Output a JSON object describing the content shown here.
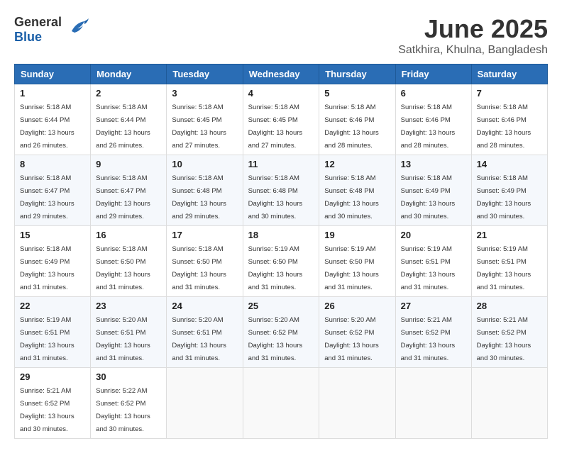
{
  "header": {
    "logo_general": "General",
    "logo_blue": "Blue",
    "month": "June 2025",
    "location": "Satkhira, Khulna, Bangladesh"
  },
  "days_of_week": [
    "Sunday",
    "Monday",
    "Tuesday",
    "Wednesday",
    "Thursday",
    "Friday",
    "Saturday"
  ],
  "weeks": [
    [
      {
        "day": "1",
        "sunrise": "Sunrise: 5:18 AM",
        "sunset": "Sunset: 6:44 PM",
        "daylight": "Daylight: 13 hours and 26 minutes."
      },
      {
        "day": "2",
        "sunrise": "Sunrise: 5:18 AM",
        "sunset": "Sunset: 6:44 PM",
        "daylight": "Daylight: 13 hours and 26 minutes."
      },
      {
        "day": "3",
        "sunrise": "Sunrise: 5:18 AM",
        "sunset": "Sunset: 6:45 PM",
        "daylight": "Daylight: 13 hours and 27 minutes."
      },
      {
        "day": "4",
        "sunrise": "Sunrise: 5:18 AM",
        "sunset": "Sunset: 6:45 PM",
        "daylight": "Daylight: 13 hours and 27 minutes."
      },
      {
        "day": "5",
        "sunrise": "Sunrise: 5:18 AM",
        "sunset": "Sunset: 6:46 PM",
        "daylight": "Daylight: 13 hours and 28 minutes."
      },
      {
        "day": "6",
        "sunrise": "Sunrise: 5:18 AM",
        "sunset": "Sunset: 6:46 PM",
        "daylight": "Daylight: 13 hours and 28 minutes."
      },
      {
        "day": "7",
        "sunrise": "Sunrise: 5:18 AM",
        "sunset": "Sunset: 6:46 PM",
        "daylight": "Daylight: 13 hours and 28 minutes."
      }
    ],
    [
      {
        "day": "8",
        "sunrise": "Sunrise: 5:18 AM",
        "sunset": "Sunset: 6:47 PM",
        "daylight": "Daylight: 13 hours and 29 minutes."
      },
      {
        "day": "9",
        "sunrise": "Sunrise: 5:18 AM",
        "sunset": "Sunset: 6:47 PM",
        "daylight": "Daylight: 13 hours and 29 minutes."
      },
      {
        "day": "10",
        "sunrise": "Sunrise: 5:18 AM",
        "sunset": "Sunset: 6:48 PM",
        "daylight": "Daylight: 13 hours and 29 minutes."
      },
      {
        "day": "11",
        "sunrise": "Sunrise: 5:18 AM",
        "sunset": "Sunset: 6:48 PM",
        "daylight": "Daylight: 13 hours and 30 minutes."
      },
      {
        "day": "12",
        "sunrise": "Sunrise: 5:18 AM",
        "sunset": "Sunset: 6:48 PM",
        "daylight": "Daylight: 13 hours and 30 minutes."
      },
      {
        "day": "13",
        "sunrise": "Sunrise: 5:18 AM",
        "sunset": "Sunset: 6:49 PM",
        "daylight": "Daylight: 13 hours and 30 minutes."
      },
      {
        "day": "14",
        "sunrise": "Sunrise: 5:18 AM",
        "sunset": "Sunset: 6:49 PM",
        "daylight": "Daylight: 13 hours and 30 minutes."
      }
    ],
    [
      {
        "day": "15",
        "sunrise": "Sunrise: 5:18 AM",
        "sunset": "Sunset: 6:49 PM",
        "daylight": "Daylight: 13 hours and 31 minutes."
      },
      {
        "day": "16",
        "sunrise": "Sunrise: 5:18 AM",
        "sunset": "Sunset: 6:50 PM",
        "daylight": "Daylight: 13 hours and 31 minutes."
      },
      {
        "day": "17",
        "sunrise": "Sunrise: 5:18 AM",
        "sunset": "Sunset: 6:50 PM",
        "daylight": "Daylight: 13 hours and 31 minutes."
      },
      {
        "day": "18",
        "sunrise": "Sunrise: 5:19 AM",
        "sunset": "Sunset: 6:50 PM",
        "daylight": "Daylight: 13 hours and 31 minutes."
      },
      {
        "day": "19",
        "sunrise": "Sunrise: 5:19 AM",
        "sunset": "Sunset: 6:50 PM",
        "daylight": "Daylight: 13 hours and 31 minutes."
      },
      {
        "day": "20",
        "sunrise": "Sunrise: 5:19 AM",
        "sunset": "Sunset: 6:51 PM",
        "daylight": "Daylight: 13 hours and 31 minutes."
      },
      {
        "day": "21",
        "sunrise": "Sunrise: 5:19 AM",
        "sunset": "Sunset: 6:51 PM",
        "daylight": "Daylight: 13 hours and 31 minutes."
      }
    ],
    [
      {
        "day": "22",
        "sunrise": "Sunrise: 5:19 AM",
        "sunset": "Sunset: 6:51 PM",
        "daylight": "Daylight: 13 hours and 31 minutes."
      },
      {
        "day": "23",
        "sunrise": "Sunrise: 5:20 AM",
        "sunset": "Sunset: 6:51 PM",
        "daylight": "Daylight: 13 hours and 31 minutes."
      },
      {
        "day": "24",
        "sunrise": "Sunrise: 5:20 AM",
        "sunset": "Sunset: 6:51 PM",
        "daylight": "Daylight: 13 hours and 31 minutes."
      },
      {
        "day": "25",
        "sunrise": "Sunrise: 5:20 AM",
        "sunset": "Sunset: 6:52 PM",
        "daylight": "Daylight: 13 hours and 31 minutes."
      },
      {
        "day": "26",
        "sunrise": "Sunrise: 5:20 AM",
        "sunset": "Sunset: 6:52 PM",
        "daylight": "Daylight: 13 hours and 31 minutes."
      },
      {
        "day": "27",
        "sunrise": "Sunrise: 5:21 AM",
        "sunset": "Sunset: 6:52 PM",
        "daylight": "Daylight: 13 hours and 31 minutes."
      },
      {
        "day": "28",
        "sunrise": "Sunrise: 5:21 AM",
        "sunset": "Sunset: 6:52 PM",
        "daylight": "Daylight: 13 hours and 30 minutes."
      }
    ],
    [
      {
        "day": "29",
        "sunrise": "Sunrise: 5:21 AM",
        "sunset": "Sunset: 6:52 PM",
        "daylight": "Daylight: 13 hours and 30 minutes."
      },
      {
        "day": "30",
        "sunrise": "Sunrise: 5:22 AM",
        "sunset": "Sunset: 6:52 PM",
        "daylight": "Daylight: 13 hours and 30 minutes."
      },
      null,
      null,
      null,
      null,
      null
    ]
  ]
}
